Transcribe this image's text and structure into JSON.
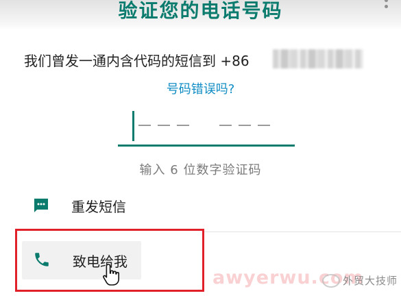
{
  "header": {
    "title": "验证您的电话号码"
  },
  "message": {
    "text": "我们曾发一通内含代码的短信到 +86"
  },
  "wrong_number_link": "号码错误吗?",
  "code_input": {
    "hint": "输入 6 位数字验证码",
    "digits_entered": 0,
    "total_digits": 6
  },
  "options": {
    "resend_sms": "重发短信",
    "call_me": "致电给我"
  },
  "watermark": {
    "text": "awyerwu.com",
    "brand": "外贸大技师"
  },
  "colors": {
    "accent": "#0b7b6e",
    "link": "#0f8cc4",
    "highlight": "#e2202a"
  }
}
